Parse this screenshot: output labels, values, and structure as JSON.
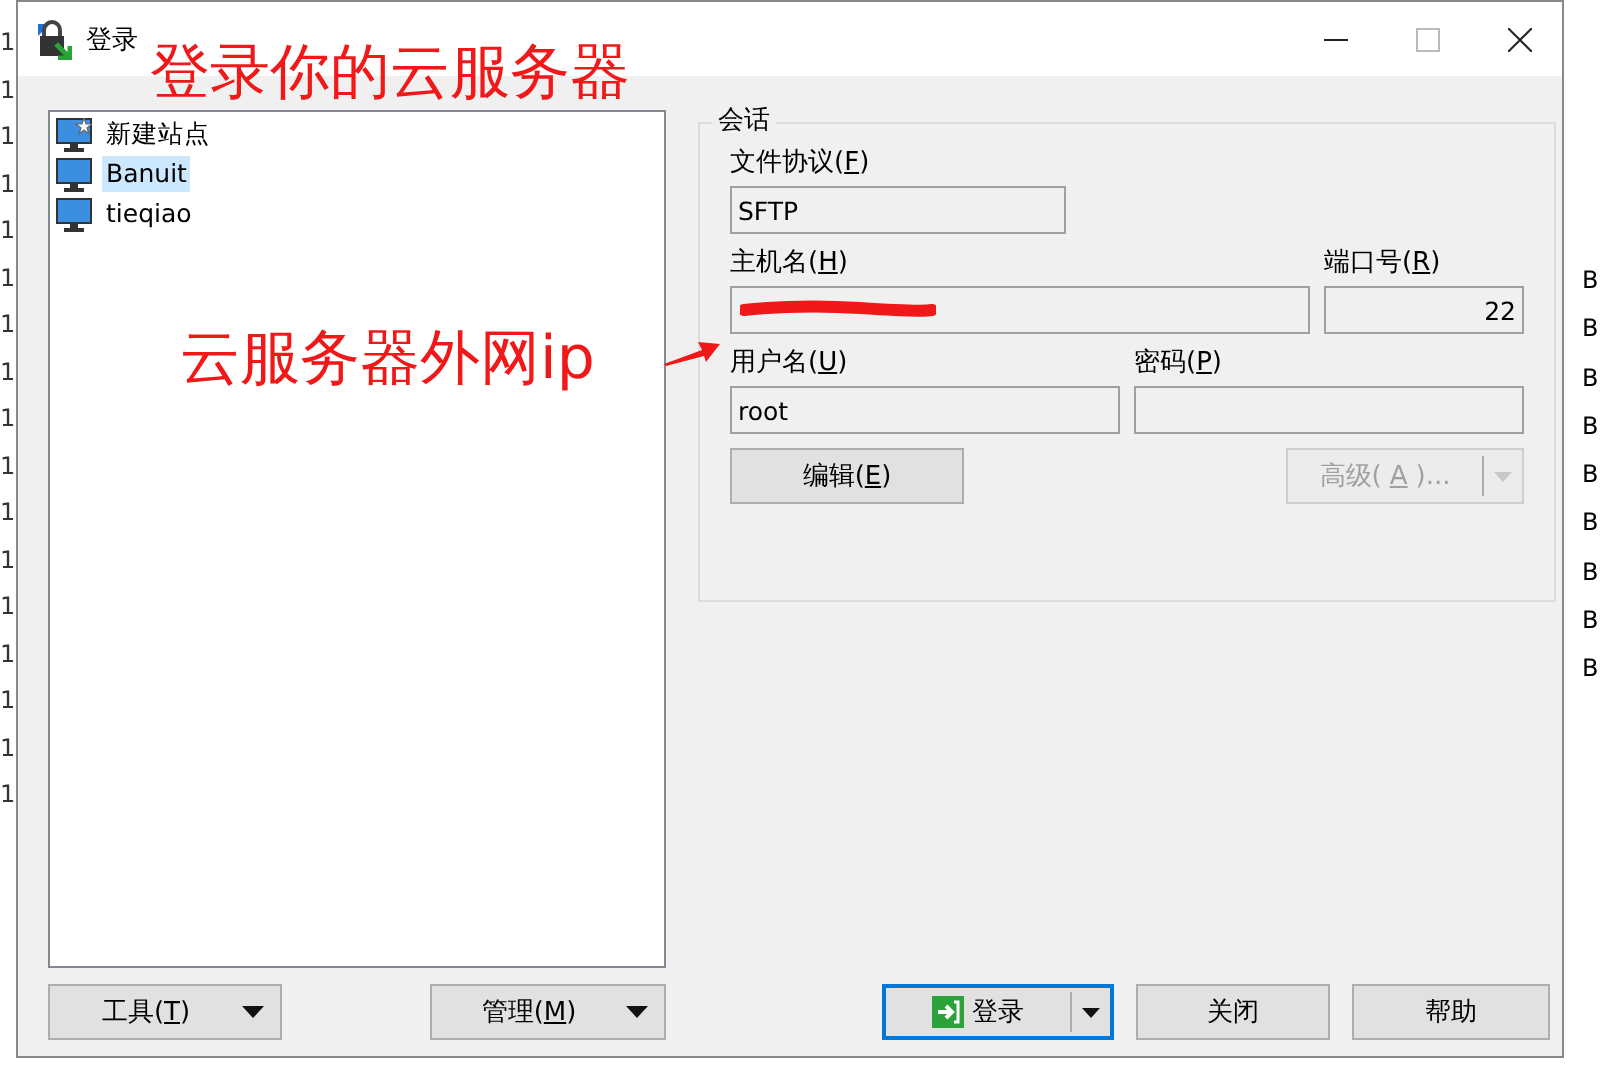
{
  "background": {
    "left_fragments": [
      "1",
      "1",
      "1",
      "1",
      "1",
      "1",
      "1",
      "1",
      "1",
      "1",
      "1",
      "1",
      "1",
      "1",
      "1",
      "1",
      "1"
    ],
    "right_fragments": [
      "B",
      "B",
      "B",
      "B",
      "B",
      "B",
      "B",
      "B",
      "B"
    ]
  },
  "window": {
    "title": "登录"
  },
  "annotations": [
    {
      "text": "登录你的云服务器"
    },
    {
      "text": "云服务器外网ip"
    }
  ],
  "sites": [
    {
      "label": "新建站点",
      "kind": "new",
      "selected": false
    },
    {
      "label": "Banuit",
      "kind": "site",
      "selected": true
    },
    {
      "label": "tieqiao",
      "kind": "site",
      "selected": false
    }
  ],
  "session": {
    "title": "会话",
    "protocol": {
      "label": {
        "before": "文件协议(",
        "accel": "F",
        "after": ")"
      },
      "value": "SFTP"
    },
    "host": {
      "label": {
        "before": "主机名(",
        "accel": "H",
        "after": ")"
      },
      "redacted": true
    },
    "port": {
      "label": {
        "before": "端口号(",
        "accel": "R",
        "after": ")"
      },
      "value": "22"
    },
    "user": {
      "label": {
        "before": "用户名(",
        "accel": "U",
        "after": ")"
      },
      "value": "root"
    },
    "password": {
      "label": {
        "before": "密码(",
        "accel": "P",
        "after": ")"
      }
    },
    "edit_button": {
      "before": "编辑(",
      "accel": "E",
      "after": ")",
      "disabled": false
    },
    "advanced_button": {
      "before": "高级(",
      "accel": "A",
      "after": ")...",
      "disabled": true
    }
  },
  "bottom_buttons": {
    "tools": {
      "before": "工具(",
      "accel": "T",
      "after": ")"
    },
    "manage": {
      "before": "管理(",
      "accel": "M",
      "after": ")"
    },
    "login": {
      "label": "登录",
      "default": true
    },
    "close": {
      "label": "关闭"
    },
    "help": {
      "label": "帮助"
    }
  }
}
